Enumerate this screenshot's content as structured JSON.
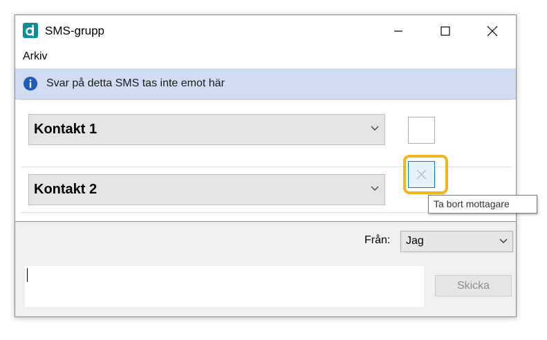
{
  "window": {
    "title": "SMS-grupp",
    "logo_icon": "dexter-d-logo",
    "controls": [
      "minimize-icon",
      "maximize-icon",
      "close-icon"
    ]
  },
  "menu": {
    "items": [
      "Arkiv"
    ]
  },
  "info_bar": {
    "icon": "info-icon",
    "text": "Svar på detta SMS tas inte emot här",
    "background_color": "#cfdcf2"
  },
  "contacts": [
    {
      "label": "Kontakt 1",
      "remove_icon": "close-icon"
    },
    {
      "label": "Kontakt 2",
      "remove_icon": "close-icon",
      "focused": true
    }
  ],
  "tooltip": {
    "text": "Ta bort mottagare"
  },
  "from": {
    "label": "Från:",
    "selected": "Jag"
  },
  "message": {
    "value": ""
  },
  "send_button": {
    "label": "Skicka",
    "disabled": true
  },
  "colors": {
    "accent": "#0b8e9b",
    "highlight": "#f2b51e",
    "focus": "#0a78d7"
  }
}
